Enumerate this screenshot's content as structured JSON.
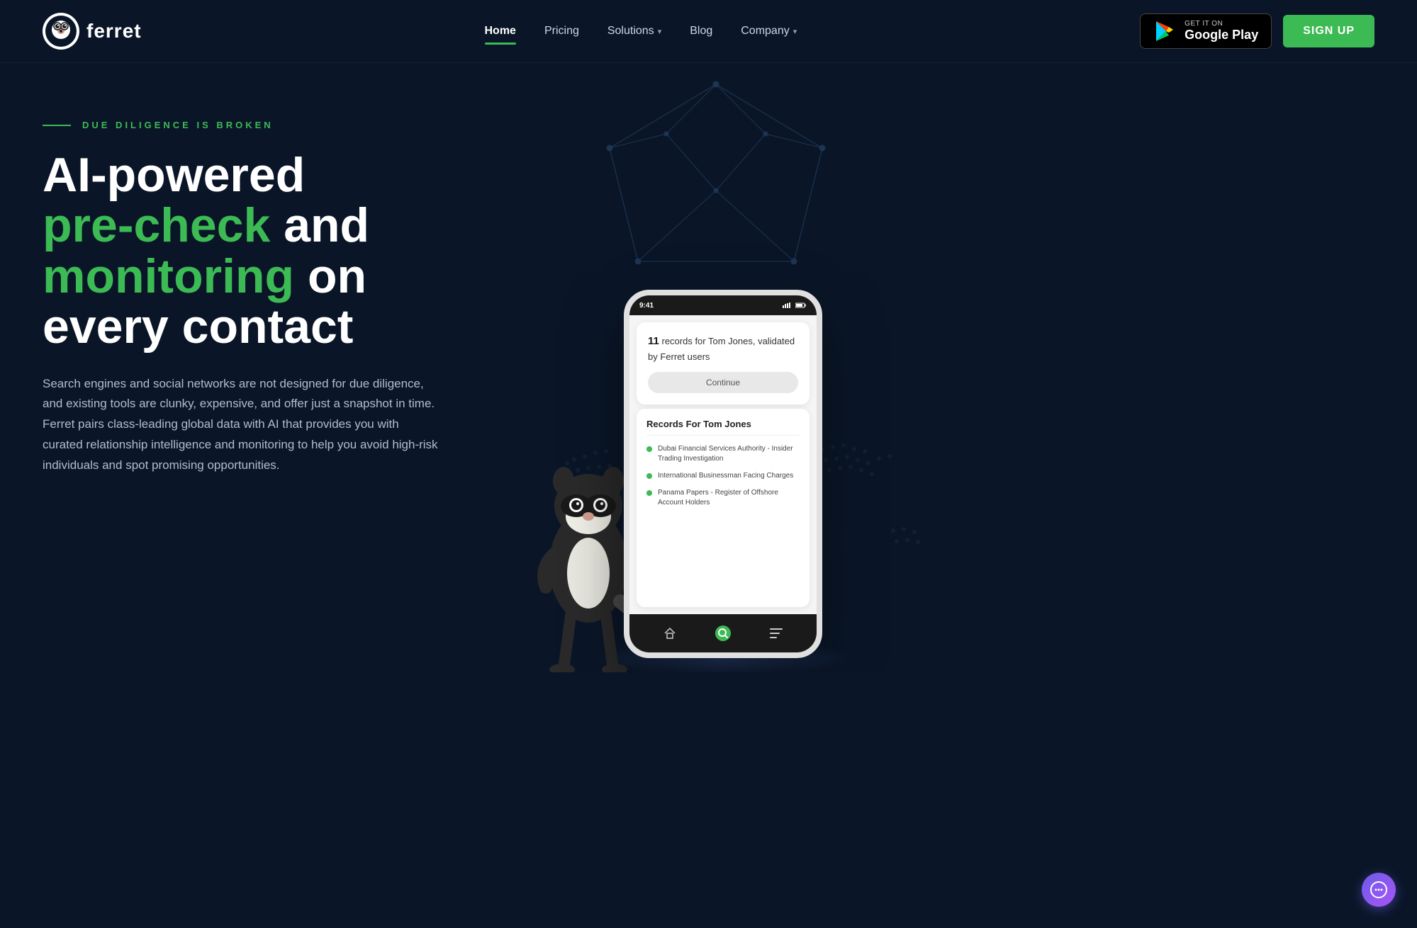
{
  "brand": {
    "name": "ferret",
    "logo_alt": "ferret logo"
  },
  "navbar": {
    "links": [
      {
        "id": "home",
        "label": "Home",
        "active": true,
        "has_dropdown": false
      },
      {
        "id": "pricing",
        "label": "Pricing",
        "active": false,
        "has_dropdown": false
      },
      {
        "id": "solutions",
        "label": "Solutions",
        "active": false,
        "has_dropdown": true
      },
      {
        "id": "blog",
        "label": "Blog",
        "active": false,
        "has_dropdown": false
      },
      {
        "id": "company",
        "label": "Company",
        "active": false,
        "has_dropdown": true
      }
    ],
    "google_play": {
      "top": "GET IT ON",
      "bottom": "Google Play"
    },
    "signup_label": "SIGN UP"
  },
  "hero": {
    "tag": "DUE DILIGENCE IS BROKEN",
    "title_part1": "AI-powered",
    "title_green1": "pre-check",
    "title_part2": "and",
    "title_green2": "monitoring",
    "title_part3": "on every contact",
    "description": "Search engines and social networks are not designed for due diligence, and existing tools are clunky, expensive, and offer just a snapshot in time. Ferret pairs class-leading global data with AI that provides you with curated relationship intelligence and monitoring to help you avoid high-risk individuals and spot promising opportunities."
  },
  "phone": {
    "time": "9:41",
    "card_top": {
      "number": "11",
      "text": " records for Tom Jones, validated by Ferret users",
      "button": "Continue"
    },
    "card_bottom": {
      "title": "Records For Tom Jones",
      "items": [
        "Dubai Financial Services Authority - Insider Trading Investigation",
        "International Businessman Facing Charges",
        "Panama Papers - Register of Offshore Account Holders"
      ]
    }
  },
  "colors": {
    "bg": "#0a1628",
    "green": "#3cba54",
    "text_muted": "#b0bcd0"
  }
}
